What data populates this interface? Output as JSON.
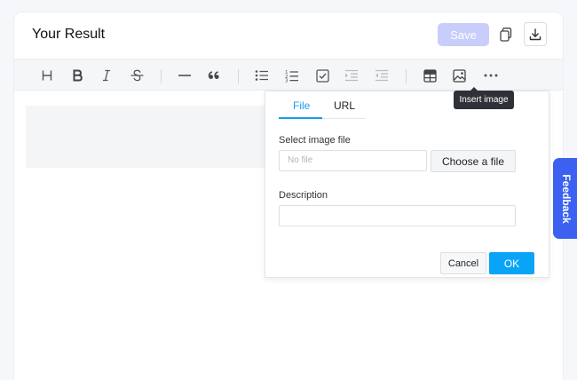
{
  "header": {
    "title": "Your Result",
    "save_label": "Save",
    "copy_icon": "copy-icon",
    "download_icon": "download-icon"
  },
  "toolbar": {
    "items": [
      {
        "name": "heading",
        "icon": "heading-icon"
      },
      {
        "name": "bold",
        "icon": "bold-icon"
      },
      {
        "name": "italic",
        "icon": "italic-icon"
      },
      {
        "name": "strikethrough",
        "icon": "strikethrough-icon"
      },
      {
        "name": "horizontal-rule",
        "icon": "horizontal-rule-icon"
      },
      {
        "name": "quote",
        "icon": "quote-icon"
      },
      {
        "name": "bullet-list",
        "icon": "bullet-list-icon"
      },
      {
        "name": "ordered-list",
        "icon": "ordered-list-icon"
      },
      {
        "name": "task-list",
        "icon": "checkbox-icon"
      },
      {
        "name": "indent",
        "icon": "indent-icon"
      },
      {
        "name": "outdent",
        "icon": "outdent-icon"
      },
      {
        "name": "table",
        "icon": "table-icon"
      },
      {
        "name": "image",
        "icon": "image-icon"
      },
      {
        "name": "more",
        "icon": "more-icon"
      }
    ],
    "tooltip": "Insert image"
  },
  "popup": {
    "tabs": [
      "File",
      "URL"
    ],
    "active_tab": "File",
    "file_label": "Select image file",
    "file_placeholder": "No file",
    "choose_label": "Choose a file",
    "description_label": "Description",
    "description_value": "",
    "cancel_label": "Cancel",
    "ok_label": "OK"
  },
  "feedback": {
    "label": "Feedback"
  },
  "colors": {
    "accent": "#1a9bef",
    "ok_button": "#0aa4f6",
    "save_disabled": "#c9cdfb",
    "feedback_bg": "#3c61f0",
    "tooltip_bg": "#2e3238"
  }
}
